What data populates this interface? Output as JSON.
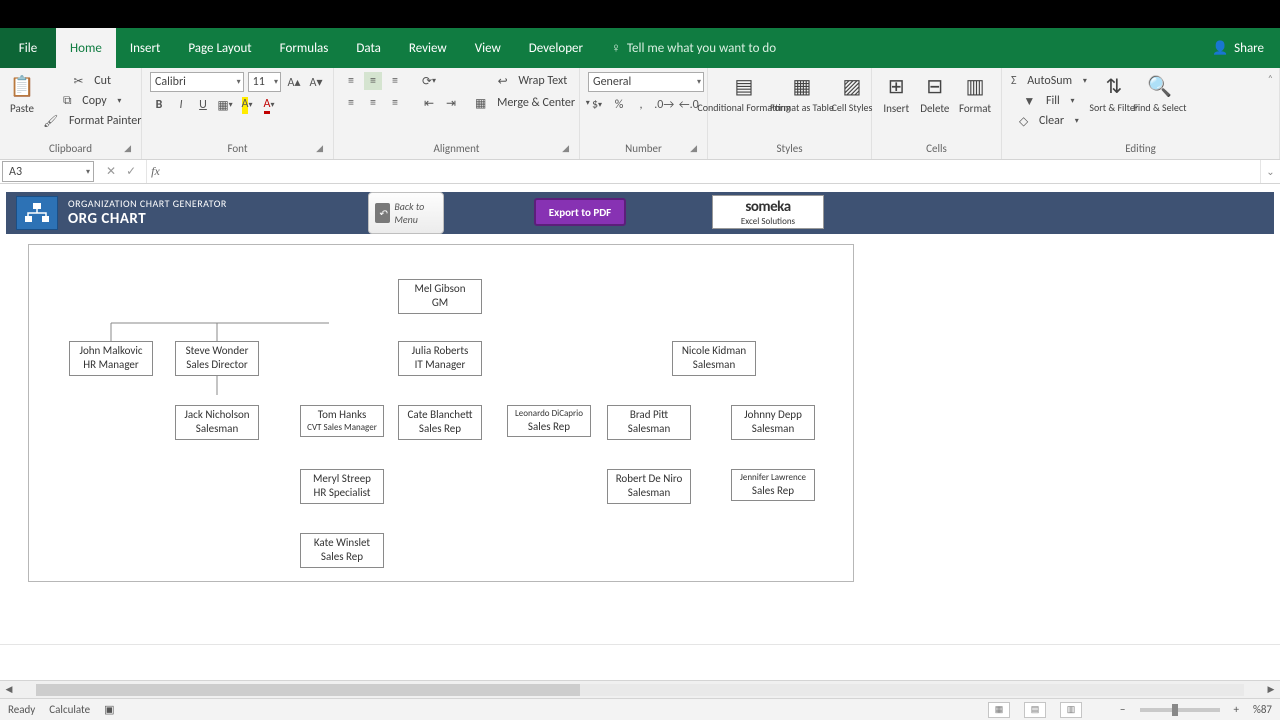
{
  "tabs": {
    "file": "File",
    "home": "Home",
    "insert": "Insert",
    "pagelayout": "Page Layout",
    "formulas": "Formulas",
    "data": "Data",
    "review": "Review",
    "view": "View",
    "developer": "Developer"
  },
  "tellme": "Tell me what you want to do",
  "share": "Share",
  "ribbon": {
    "clipboard": {
      "paste": "Paste",
      "cut": "Cut",
      "copy": "Copy",
      "painter": "Format Painter",
      "label": "Clipboard"
    },
    "font": {
      "name": "Calibri",
      "size": "11",
      "bold": "B",
      "italic": "I",
      "underline": "U",
      "label": "Font"
    },
    "alignment": {
      "wrap": "Wrap Text",
      "merge": "Merge & Center",
      "label": "Alignment"
    },
    "number": {
      "format": "General",
      "label": "Number"
    },
    "styles": {
      "cond": "Conditional Formatting",
      "table": "Format as Table",
      "cell": "Cell Styles",
      "label": "Styles"
    },
    "cells": {
      "insert": "Insert",
      "delete": "Delete",
      "format": "Format",
      "label": "Cells"
    },
    "editing": {
      "autosum": "AutoSum",
      "fill": "Fill",
      "clear": "Clear",
      "sort": "Sort & Filter",
      "find": "Find & Select",
      "label": "Editing"
    }
  },
  "namebox": "A3",
  "docheader": {
    "sub": "ORGANIZATION CHART GENERATOR",
    "main": "ORG CHART"
  },
  "back": "Back to Menu",
  "export": "Export to PDF",
  "someka": {
    "brand": "someka",
    "tag": "Excel Solutions"
  },
  "chart_data": {
    "type": "orgchart",
    "root": {
      "name": "Mel Gibson",
      "role": "GM",
      "children": [
        {
          "name": "John Malkovic",
          "role": "HR Manager",
          "children": []
        },
        {
          "name": "Steve Wonder",
          "role": "Sales Director",
          "children": [
            {
              "name": "Jack Nicholson",
              "role": "Salesman",
              "children": []
            }
          ]
        },
        {
          "name": "Julia Roberts",
          "role": "IT Manager",
          "children": [
            {
              "name": "Tom Hanks",
              "role": "CVT Sales Manager",
              "children": [
                {
                  "name": "Meryl Streep",
                  "role": "HR Specialist",
                  "children": [
                    {
                      "name": "Kate Winslet",
                      "role": "Sales Rep",
                      "children": []
                    }
                  ]
                }
              ]
            },
            {
              "name": "Cate Blanchett",
              "role": "Sales Rep",
              "children": []
            },
            {
              "name": "Leonardo DiCaprio",
              "role": "Sales Rep",
              "children": []
            }
          ]
        },
        {
          "name": "Nicole Kidman",
          "role": "Salesman",
          "children": [
            {
              "name": "Brad Pitt",
              "role": "Salesman",
              "children": [
                {
                  "name": "Robert De Niro",
                  "role": "Salesman",
                  "children": []
                }
              ]
            },
            {
              "name": "Johnny Depp",
              "role": "Salesman",
              "children": [
                {
                  "name": "Jennifer Lawrence",
                  "role": "Sales Rep",
                  "children": []
                }
              ]
            }
          ]
        }
      ]
    }
  },
  "people": {
    "mel": {
      "name": "Mel Gibson",
      "role": "GM"
    },
    "john": {
      "name": "John Malkovic",
      "role": "HR Manager"
    },
    "steve": {
      "name": "Steve Wonder",
      "role": "Sales Director"
    },
    "julia": {
      "name": "Julia Roberts",
      "role": "IT Manager"
    },
    "nicole": {
      "name": "Nicole Kidman",
      "role": "Salesman"
    },
    "jack": {
      "name": "Jack Nicholson",
      "role": "Salesman"
    },
    "tom": {
      "name": "Tom Hanks",
      "role": "CVT Sales Manager"
    },
    "cate": {
      "name": "Cate Blanchett",
      "role": "Sales Rep"
    },
    "leo": {
      "name": "Leonardo DiCaprio",
      "role": "Sales Rep"
    },
    "brad": {
      "name": "Brad Pitt",
      "role": "Salesman"
    },
    "johnny": {
      "name": "Johnny Depp",
      "role": "Salesman"
    },
    "meryl": {
      "name": "Meryl Streep",
      "role": "HR Specialist"
    },
    "robert": {
      "name": "Robert De Niro",
      "role": "Salesman"
    },
    "jennifer": {
      "name": "Jennifer Lawrence",
      "role": "Sales Rep"
    },
    "kate": {
      "name": "Kate Winslet",
      "role": "Sales Rep"
    }
  },
  "status": {
    "ready": "Ready",
    "calc": "Calculate",
    "zoom": "%87"
  }
}
